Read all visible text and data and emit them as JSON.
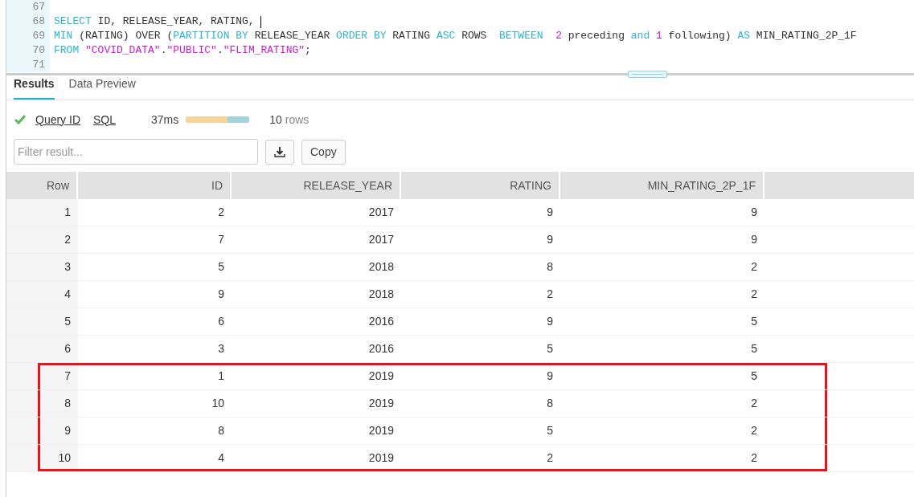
{
  "editor": {
    "lines": [
      {
        "number": "67",
        "cursor": false
      },
      {
        "number": "68",
        "tokens": [
          {
            "kind": "keyword",
            "text": "SELECT"
          },
          {
            "kind": "plain",
            "text": " ID, RELEASE_YEAR, RATING, "
          }
        ],
        "cursor": true
      },
      {
        "number": "69",
        "tokens": [
          {
            "kind": "keyword",
            "text": "MIN"
          },
          {
            "kind": "plain",
            "text": " (RATING) OVER ("
          },
          {
            "kind": "keyword",
            "text": "PARTITION BY"
          },
          {
            "kind": "plain",
            "text": " RELEASE_YEAR "
          },
          {
            "kind": "keyword",
            "text": "ORDER BY"
          },
          {
            "kind": "plain",
            "text": " RATING "
          },
          {
            "kind": "keyword",
            "text": "ASC"
          },
          {
            "kind": "plain",
            "text": " ROWS  "
          },
          {
            "kind": "keyword",
            "text": "BETWEEN"
          },
          {
            "kind": "number",
            "text": "  2"
          },
          {
            "kind": "plain",
            "text": " preceding "
          },
          {
            "kind": "keyword",
            "text": "and"
          },
          {
            "kind": "number",
            "text": " 1"
          },
          {
            "kind": "plain",
            "text": " following) "
          },
          {
            "kind": "keyword",
            "text": "AS"
          },
          {
            "kind": "plain",
            "text": " MIN_RATING_2P_1F"
          }
        ],
        "cursor": false
      },
      {
        "number": "70",
        "tokens": [
          {
            "kind": "keyword",
            "text": "FROM "
          },
          {
            "kind": "string",
            "text": "\"COVID_DATA\""
          },
          {
            "kind": "plain",
            "text": "."
          },
          {
            "kind": "string",
            "text": "\"PUBLIC\""
          },
          {
            "kind": "plain",
            "text": "."
          },
          {
            "kind": "string",
            "text": "\"FLIM_RATING\""
          },
          {
            "kind": "plain",
            "text": ";"
          }
        ],
        "cursor": false
      },
      {
        "number": "71",
        "cursor": false
      }
    ]
  },
  "tabs": [
    {
      "label": "Results",
      "selected": true
    },
    {
      "label": "Data Preview",
      "selected": false
    }
  ],
  "query_info": {
    "links": [
      "Query ID",
      "SQL"
    ],
    "duration": "37ms",
    "count": "10",
    "count_unit": "rows",
    "timing_bar": [
      {
        "level": 0.65,
        "color": "#f7d49a"
      },
      {
        "level": 0.35,
        "color": "#a5d3dc"
      }
    ]
  },
  "filter": {
    "placeholder": "Filter result..."
  },
  "copy_button": "Copy",
  "table": {
    "columns": [
      "Row",
      "ID",
      "RELEASE_YEAR",
      "RATING",
      "MIN_RATING_2P_1F"
    ],
    "rows": [
      {
        "cells": [
          "1",
          "2",
          "2017",
          "9",
          "9"
        ],
        "highlighted": false
      },
      {
        "cells": [
          "2",
          "7",
          "2017",
          "9",
          "9"
        ],
        "highlighted": false
      },
      {
        "cells": [
          "3",
          "5",
          "2018",
          "8",
          "2"
        ],
        "highlighted": false
      },
      {
        "cells": [
          "4",
          "9",
          "2018",
          "2",
          "2"
        ],
        "highlighted": false
      },
      {
        "cells": [
          "5",
          "6",
          "2016",
          "9",
          "5"
        ],
        "highlighted": false
      },
      {
        "cells": [
          "6",
          "3",
          "2016",
          "5",
          "5"
        ],
        "highlighted": false
      },
      {
        "cells": [
          "7",
          "1",
          "2019",
          "9",
          "5"
        ],
        "highlighted": true
      },
      {
        "cells": [
          "8",
          "10",
          "2019",
          "8",
          "2"
        ],
        "highlighted": true
      },
      {
        "cells": [
          "9",
          "8",
          "2019",
          "5",
          "2"
        ],
        "highlighted": true
      },
      {
        "cells": [
          "10",
          "4",
          "2019",
          "2",
          "2"
        ],
        "highlighted": true
      }
    ]
  }
}
